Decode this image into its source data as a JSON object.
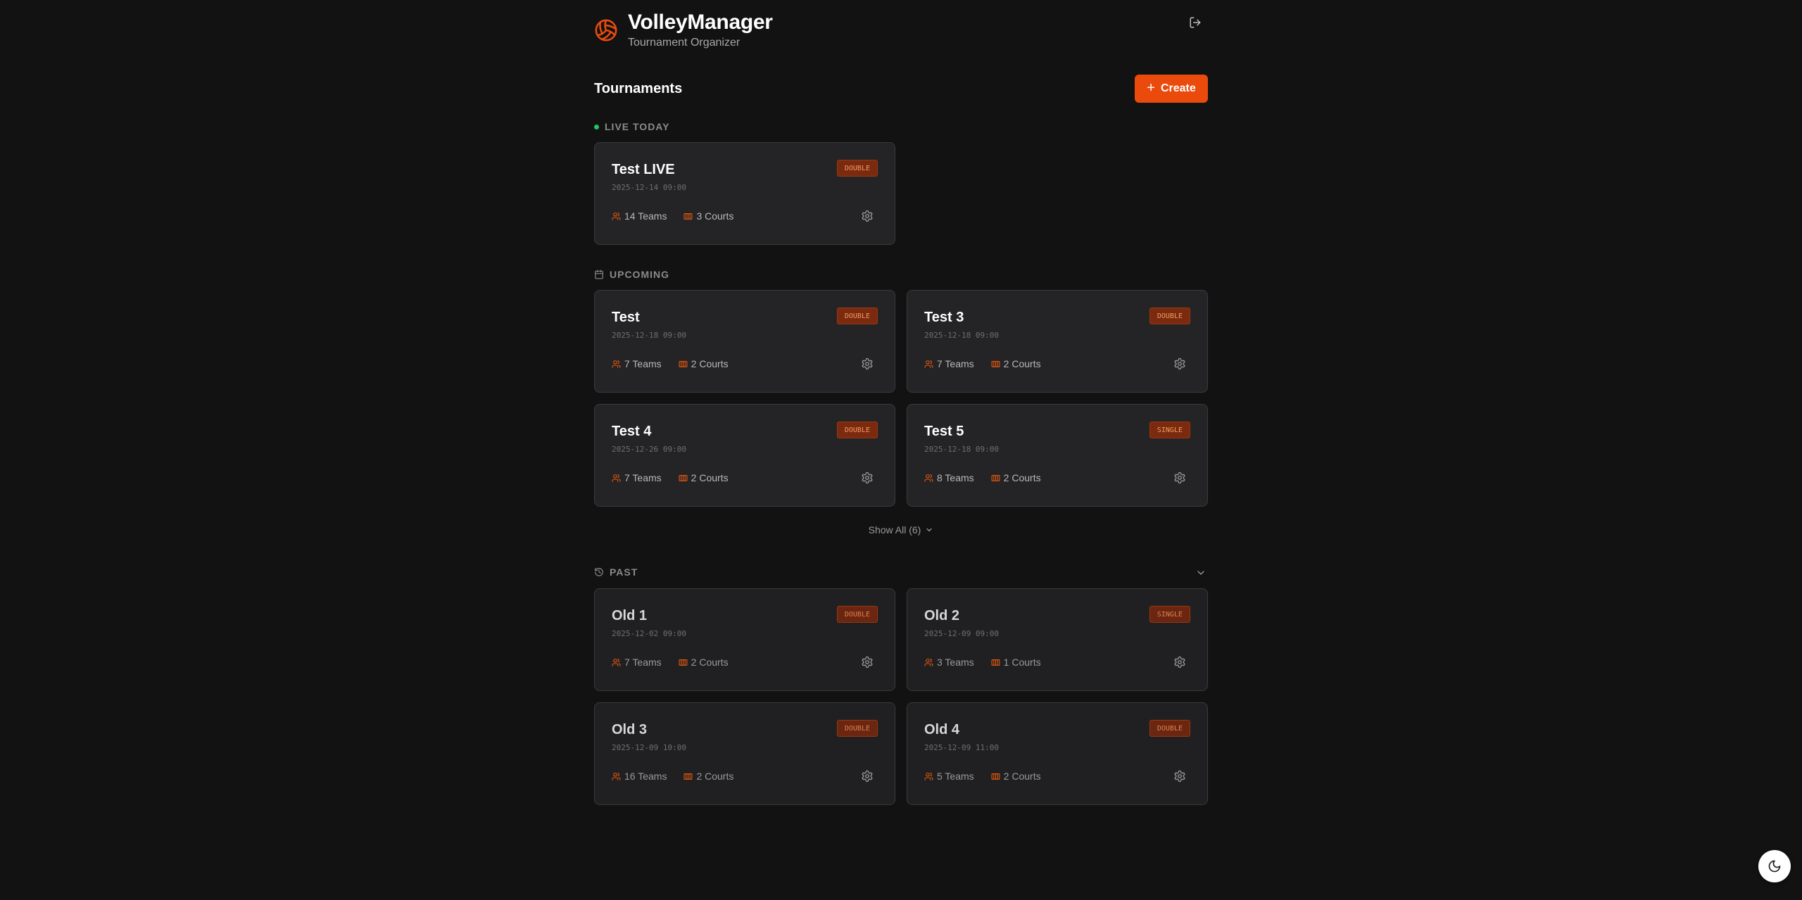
{
  "app": {
    "title": "VolleyManager",
    "subtitle": "Tournament Organizer",
    "logo_icon": "volleyball-icon",
    "logout_icon": "logout-icon",
    "accent_color": "#ea4b0d"
  },
  "toolbar": {
    "title": "Tournaments",
    "create_label": "Create",
    "create_icon": "plus-icon"
  },
  "sections": {
    "live": {
      "label": "LIVE TODAY",
      "status_color": "#22c55e"
    },
    "upcoming": {
      "label": "UPCOMING",
      "icon": "calendar-icon"
    },
    "past": {
      "label": "PAST",
      "icon": "history-icon",
      "toggle_icon": "chevron-down-icon"
    }
  },
  "live_cards": [
    {
      "name": "Test LIVE",
      "date": "2025-12-14 09:00",
      "type": "DOUBLE",
      "teams": "14 Teams",
      "courts": "3 Courts"
    }
  ],
  "upcoming_cards": [
    {
      "name": "Test",
      "date": "2025-12-18 09:00",
      "type": "DOUBLE",
      "teams": "7 Teams",
      "courts": "2 Courts"
    },
    {
      "name": "Test 3",
      "date": "2025-12-18 09:00",
      "type": "DOUBLE",
      "teams": "7 Teams",
      "courts": "2 Courts"
    },
    {
      "name": "Test 4",
      "date": "2025-12-26 09:00",
      "type": "DOUBLE",
      "teams": "7 Teams",
      "courts": "2 Courts"
    },
    {
      "name": "Test 5",
      "date": "2025-12-18 09:00",
      "type": "SINGLE",
      "teams": "8 Teams",
      "courts": "2 Courts"
    }
  ],
  "show_all_label": "Show All (6)",
  "past_cards": [
    {
      "name": "Old 1",
      "date": "2025-12-02 09:00",
      "type": "DOUBLE",
      "teams": "7 Teams",
      "courts": "2 Courts"
    },
    {
      "name": "Old 2",
      "date": "2025-12-09 09:00",
      "type": "SINGLE",
      "teams": "3 Teams",
      "courts": "1 Courts"
    },
    {
      "name": "Old 3",
      "date": "2025-12-09 10:00",
      "type": "DOUBLE",
      "teams": "16 Teams",
      "courts": "2 Courts"
    },
    {
      "name": "Old 4",
      "date": "2025-12-09 11:00",
      "type": "DOUBLE",
      "teams": "5 Teams",
      "courts": "2 Courts"
    }
  ],
  "theme_toggle_icon": "moon-icon"
}
